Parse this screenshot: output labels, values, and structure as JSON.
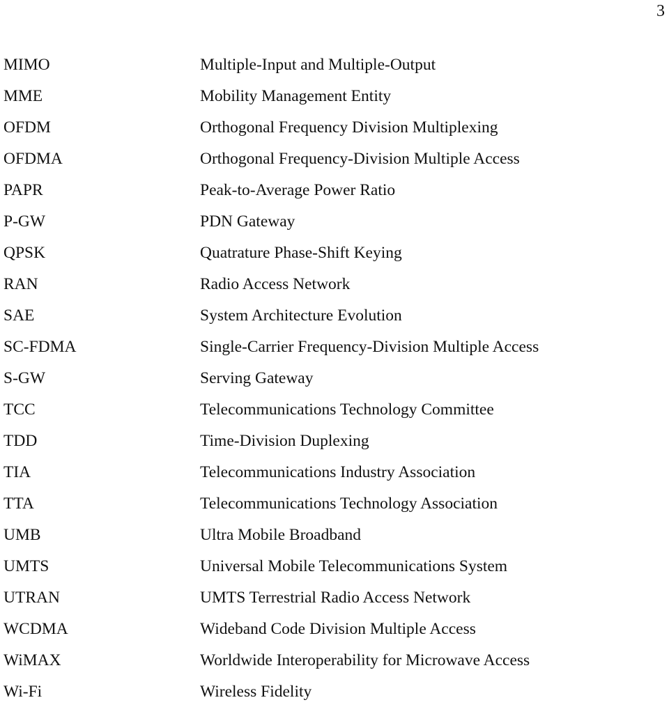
{
  "page": {
    "number": "3"
  },
  "abbreviations": [
    {
      "term": "MIMO",
      "definition": "Multiple-Input and Multiple-Output"
    },
    {
      "term": "MME",
      "definition": "Mobility Management Entity"
    },
    {
      "term": "OFDM",
      "definition": "Orthogonal Frequency Division Multiplexing"
    },
    {
      "term": "OFDMA",
      "definition": "Orthogonal Frequency-Division Multiple Access"
    },
    {
      "term": "PAPR",
      "definition": "Peak-to-Average Power Ratio"
    },
    {
      "term": "P-GW",
      "definition": "PDN Gateway"
    },
    {
      "term": "QPSK",
      "definition": "Quatrature Phase-Shift Keying"
    },
    {
      "term": "RAN",
      "definition": "Radio Access Network"
    },
    {
      "term": "SAE",
      "definition": "System Architecture Evolution"
    },
    {
      "term": "SC-FDMA",
      "definition": "Single-Carrier Frequency-Division Multiple Access"
    },
    {
      "term": "S-GW",
      "definition": "Serving Gateway"
    },
    {
      "term": "TCC",
      "definition": "Telecommunications Technology Committee"
    },
    {
      "term": "TDD",
      "definition": "Time-Division Duplexing"
    },
    {
      "term": "TIA",
      "definition": "Telecommunications Industry Association"
    },
    {
      "term": "TTA",
      "definition": "Telecommunications Technology Association"
    },
    {
      "term": "UMB",
      "definition": "Ultra Mobile Broadband"
    },
    {
      "term": "UMTS",
      "definition": "Universal Mobile Telecommunications System"
    },
    {
      "term": "UTRAN",
      "definition": "UMTS Terrestrial Radio Access Network"
    },
    {
      "term": "WCDMA",
      "definition": "Wideband Code Division Multiple Access"
    },
    {
      "term": "WiMAX",
      "definition": "Worldwide Interoperability for Microwave Access"
    },
    {
      "term": "Wi-Fi",
      "definition": "Wireless Fidelity"
    }
  ]
}
